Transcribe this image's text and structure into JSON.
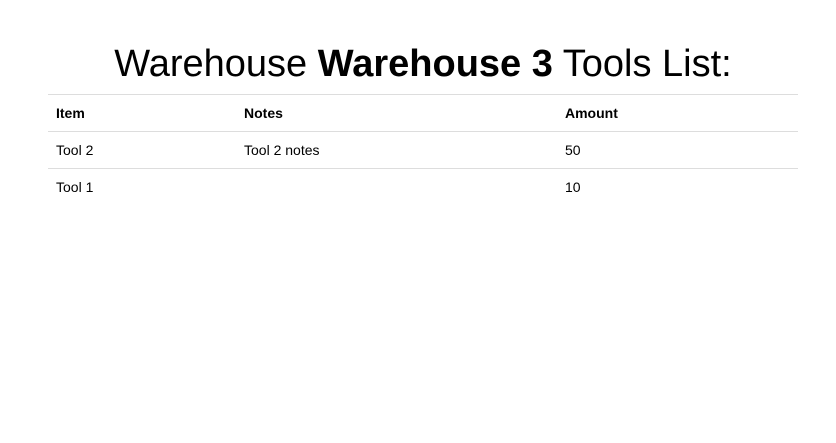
{
  "header": {
    "title_prefix": "Warehouse ",
    "title_warehouse": "Warehouse 3",
    "title_suffix": " Tools List:"
  },
  "table": {
    "columns": [
      "Item",
      "Notes",
      "Amount"
    ],
    "rows": [
      {
        "item": "Tool 2",
        "notes": "Tool 2 notes",
        "amount": "50"
      },
      {
        "item": "Tool 1",
        "notes": "",
        "amount": "10"
      }
    ]
  }
}
